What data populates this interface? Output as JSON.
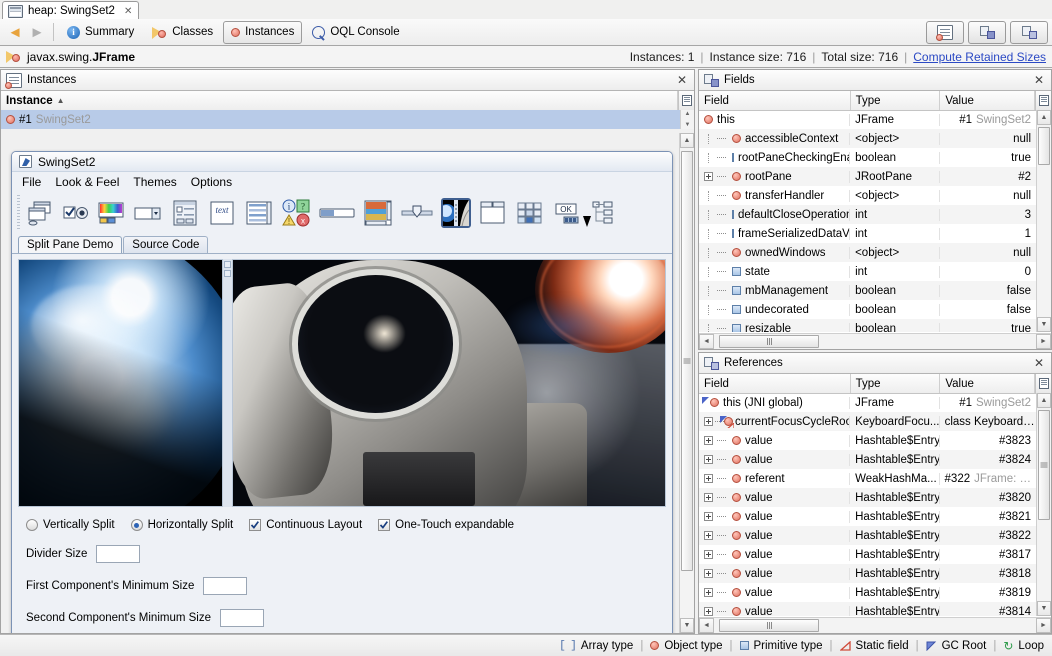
{
  "document_tab": {
    "label": "heap: SwingSet2",
    "close": "✕",
    "icon": "heap-icon"
  },
  "toolbar": {
    "back": "◄",
    "forward": "►",
    "items": [
      {
        "label": "Summary",
        "icon": "info-icon",
        "selected": false
      },
      {
        "label": "Classes",
        "icon": "classes-icon",
        "selected": false
      },
      {
        "label": "Instances",
        "icon": "instance-icon",
        "selected": true
      },
      {
        "label": "OQL Console",
        "icon": "oql-icon",
        "selected": false
      }
    ],
    "right_buttons": [
      {
        "name": "instances-view-button"
      },
      {
        "name": "fields-view-button"
      },
      {
        "name": "references-view-button"
      }
    ]
  },
  "class_bar": {
    "icon": "classes-icon",
    "package": "javax.swing.",
    "class_name": "JFrame",
    "instances_label": "Instances: 1",
    "instance_size_label": "Instance size: 716",
    "total_size_label": "Total size: 716",
    "compute_link": "Compute Retained Sizes",
    "separator": "|"
  },
  "instances_panel": {
    "title": "Instances",
    "icon": "instances-panel-icon",
    "close": "✕",
    "column": "Instance",
    "sort_arrow": "▲",
    "rows": [
      {
        "id": "#1",
        "name": "SwingSet2",
        "selected": true,
        "icon": "object-type-icon"
      }
    ]
  },
  "fields_panel": {
    "title": "Fields",
    "icon": "fields-panel-icon",
    "close": "✕",
    "columns": [
      "Field",
      "Type",
      "Value"
    ],
    "rows": [
      {
        "field": "this",
        "type": "JFrame",
        "value": "#1",
        "value_dim": "SwingSet2",
        "icon": "object-type-icon",
        "depth": 0,
        "expandable": false
      },
      {
        "field": "accessibleContext",
        "type": "<object>",
        "value": "null",
        "value_dim": "",
        "icon": "object-type-icon",
        "depth": 1,
        "expandable": false
      },
      {
        "field": "rootPaneCheckingEnabl",
        "type": "boolean",
        "value": "true",
        "value_dim": "",
        "icon": "primitive-type-icon",
        "depth": 1,
        "expandable": false
      },
      {
        "field": "rootPane",
        "type": "JRootPane",
        "value": "#2",
        "value_dim": "",
        "icon": "object-type-icon",
        "depth": 1,
        "expandable": true
      },
      {
        "field": "transferHandler",
        "type": "<object>",
        "value": "null",
        "value_dim": "",
        "icon": "object-type-icon",
        "depth": 1,
        "expandable": false
      },
      {
        "field": "defaultCloseOperation",
        "type": "int",
        "value": "3",
        "value_dim": "",
        "icon": "primitive-type-icon",
        "depth": 1,
        "expandable": false
      },
      {
        "field": "frameSerializedDataVer:",
        "type": "int",
        "value": "1",
        "value_dim": "",
        "icon": "primitive-type-icon",
        "depth": 1,
        "expandable": false
      },
      {
        "field": "ownedWindows",
        "type": "<object>",
        "value": "null",
        "value_dim": "",
        "icon": "object-type-icon",
        "depth": 1,
        "expandable": false
      },
      {
        "field": "state",
        "type": "int",
        "value": "0",
        "value_dim": "",
        "icon": "primitive-type-icon",
        "depth": 1,
        "expandable": false
      },
      {
        "field": "mbManagement",
        "type": "boolean",
        "value": "false",
        "value_dim": "",
        "icon": "primitive-type-icon",
        "depth": 1,
        "expandable": false
      },
      {
        "field": "undecorated",
        "type": "boolean",
        "value": "false",
        "value_dim": "",
        "icon": "primitive-type-icon",
        "depth": 1,
        "expandable": false
      },
      {
        "field": "resizable",
        "type": "boolean",
        "value": "true",
        "value_dim": "",
        "icon": "primitive-type-icon",
        "depth": 1,
        "expandable": false
      }
    ]
  },
  "references_panel": {
    "title": "References",
    "icon": "references-panel-icon",
    "close": "✕",
    "columns": [
      "Field",
      "Type",
      "Value"
    ],
    "rows": [
      {
        "field": "this (JNI global)",
        "type": "JFrame",
        "value": "#1",
        "value_dim": "SwingSet2",
        "icon": "object-type-icon",
        "depth": 0,
        "expandable": false,
        "gcroot": true,
        "static": false
      },
      {
        "field": "currentFocusCycleRoot",
        "type": "KeyboardFocu...",
        "value": "class Keyboard…",
        "value_dim": "",
        "icon": "object-type-icon",
        "depth": 1,
        "expandable": true,
        "gcroot": true,
        "static": true
      },
      {
        "field": "value",
        "type": "Hashtable$Entry",
        "value": "#3823",
        "value_dim": "",
        "icon": "object-type-icon",
        "depth": 1,
        "expandable": true,
        "gcroot": false,
        "static": false
      },
      {
        "field": "value",
        "type": "Hashtable$Entry",
        "value": "#3824",
        "value_dim": "",
        "icon": "object-type-icon",
        "depth": 1,
        "expandable": true,
        "gcroot": false,
        "static": false
      },
      {
        "field": "referent",
        "type": "WeakHashMa...",
        "value": "#322",
        "value_dim": "JFrame: …",
        "icon": "object-type-icon",
        "depth": 1,
        "expandable": true,
        "gcroot": false,
        "static": false
      },
      {
        "field": "value",
        "type": "Hashtable$Entry",
        "value": "#3820",
        "value_dim": "",
        "icon": "object-type-icon",
        "depth": 1,
        "expandable": true,
        "gcroot": false,
        "static": false
      },
      {
        "field": "value",
        "type": "Hashtable$Entry",
        "value": "#3821",
        "value_dim": "",
        "icon": "object-type-icon",
        "depth": 1,
        "expandable": true,
        "gcroot": false,
        "static": false
      },
      {
        "field": "value",
        "type": "Hashtable$Entry",
        "value": "#3822",
        "value_dim": "",
        "icon": "object-type-icon",
        "depth": 1,
        "expandable": true,
        "gcroot": false,
        "static": false
      },
      {
        "field": "value",
        "type": "Hashtable$Entry",
        "value": "#3817",
        "value_dim": "",
        "icon": "object-type-icon",
        "depth": 1,
        "expandable": true,
        "gcroot": false,
        "static": false
      },
      {
        "field": "value",
        "type": "Hashtable$Entry",
        "value": "#3818",
        "value_dim": "",
        "icon": "object-type-icon",
        "depth": 1,
        "expandable": true,
        "gcroot": false,
        "static": false
      },
      {
        "field": "value",
        "type": "Hashtable$Entry",
        "value": "#3819",
        "value_dim": "",
        "icon": "object-type-icon",
        "depth": 1,
        "expandable": true,
        "gcroot": false,
        "static": false
      },
      {
        "field": "value",
        "type": "Hashtable$Entry",
        "value": "#3814",
        "value_dim": "",
        "icon": "object-type-icon",
        "depth": 1,
        "expandable": true,
        "gcroot": false,
        "static": false
      }
    ]
  },
  "swingset_window": {
    "title": "SwingSet2",
    "icon": "java-cup-icon",
    "menus": [
      "File",
      "Look & Feel",
      "Themes",
      "Options"
    ],
    "toolbar_icons": [
      "internal-frame-demo-icon",
      "button-demo-icon",
      "color-chooser-demo-icon",
      "combobox-demo-icon",
      "file-chooser-demo-icon",
      "html-demo-icon",
      "list-demo-icon",
      "option-pane-demo-icon",
      "progressbar-demo-icon",
      "scrollpane-demo-icon",
      "slider-demo-icon",
      "split-pane-demo-icon",
      "tabbed-pane-demo-icon",
      "table-demo-icon",
      "text-field-demo-icon",
      "tree-demo-icon"
    ],
    "selected_toolbar_icon": "split-pane-demo-icon",
    "tabs": [
      {
        "label": "Split Pane Demo",
        "active": true
      },
      {
        "label": "Source Code",
        "active": false
      }
    ],
    "left_image_alt": "Earth from space",
    "right_image_alt": "Astronaut spacewalk",
    "controls": {
      "vertically_split": {
        "label": "Vertically Split",
        "type": "radio",
        "checked": false
      },
      "horizontally_split": {
        "label": "Horizontally Split",
        "type": "radio",
        "checked": true
      },
      "continuous_layout": {
        "label": "Continuous Layout",
        "type": "checkbox",
        "checked": true
      },
      "one_touch": {
        "label": "One-Touch expandable",
        "type": "checkbox",
        "checked": true
      },
      "divider_size": {
        "label": "Divider Size",
        "value": ""
      },
      "first_min_size": {
        "label": "First Component's Minimum Size",
        "value": ""
      },
      "second_min_size": {
        "label": "Second Component's Minimum Size",
        "value": ""
      }
    }
  },
  "status_bar": {
    "legend": [
      {
        "label": "Array type",
        "icon": "array-type-icon"
      },
      {
        "label": "Object type",
        "icon": "object-type-icon"
      },
      {
        "label": "Primitive type",
        "icon": "primitive-type-icon"
      },
      {
        "label": "Static field",
        "icon": "static-field-icon"
      },
      {
        "label": "GC Root",
        "icon": "gc-root-icon"
      },
      {
        "label": "Loop",
        "icon": "loop-icon"
      }
    ],
    "separator": "|",
    "array_glyph": "[ ]",
    "loop_glyph": "↻"
  },
  "colors": {
    "selection": "#b8cbe8",
    "link": "#2b49c4",
    "object_type": "#e0705f",
    "primitive_type": "#a9c6e6",
    "gc_root": "#4b64c8",
    "static_field": "#d04b3a"
  }
}
